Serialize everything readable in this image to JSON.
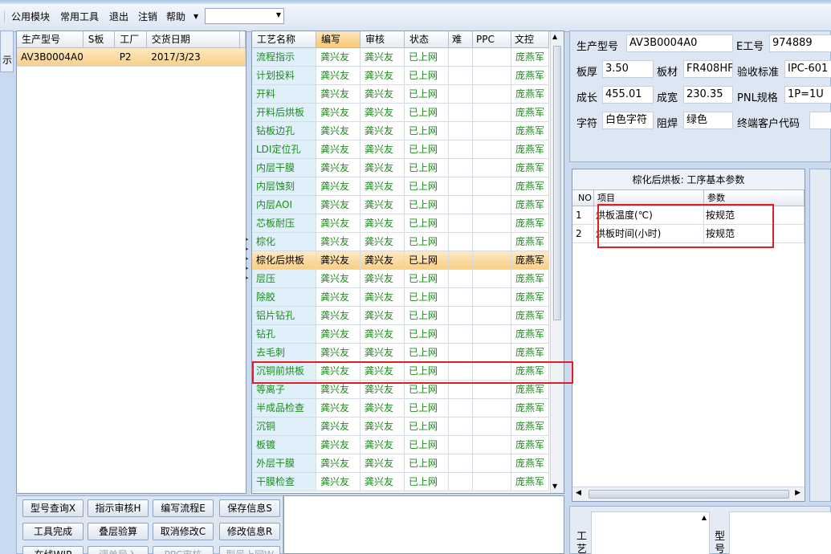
{
  "menu": {
    "items": [
      "公用模块",
      "常用工具",
      "退出",
      "注销",
      "帮助"
    ],
    "combo_value": ""
  },
  "left_stub_text": "示",
  "orders": {
    "headers": [
      "生产型号",
      "S板",
      "工厂",
      "交货日期"
    ],
    "rows": [
      [
        "AV3B0004A0",
        "",
        "P2",
        "2017/3/23"
      ]
    ]
  },
  "process": {
    "headers": [
      "工艺名称",
      "编写",
      "审核",
      "状态",
      "难",
      "PPC",
      "文控"
    ],
    "rows": [
      [
        "流程指示",
        "龚兴友",
        "龚兴友",
        "已上网",
        "",
        "",
        "庞燕军"
      ],
      [
        "计划投料",
        "龚兴友",
        "龚兴友",
        "已上网",
        "",
        "",
        "庞燕军"
      ],
      [
        "开料",
        "龚兴友",
        "龚兴友",
        "已上网",
        "",
        "",
        "庞燕军"
      ],
      [
        "开料后烘板",
        "龚兴友",
        "龚兴友",
        "已上网",
        "",
        "",
        "庞燕军"
      ],
      [
        "钻板边孔",
        "龚兴友",
        "龚兴友",
        "已上网",
        "",
        "",
        "庞燕军"
      ],
      [
        "LDI定位孔",
        "龚兴友",
        "龚兴友",
        "已上网",
        "",
        "",
        "庞燕军"
      ],
      [
        "内层干膜",
        "龚兴友",
        "龚兴友",
        "已上网",
        "",
        "",
        "庞燕军"
      ],
      [
        "内层蚀刻",
        "龚兴友",
        "龚兴友",
        "已上网",
        "",
        "",
        "庞燕军"
      ],
      [
        "内层AOI",
        "龚兴友",
        "龚兴友",
        "已上网",
        "",
        "",
        "庞燕军"
      ],
      [
        "芯板耐压",
        "龚兴友",
        "龚兴友",
        "已上网",
        "",
        "",
        "庞燕军"
      ],
      [
        "棕化",
        "龚兴友",
        "龚兴友",
        "已上网",
        "",
        "",
        "庞燕军"
      ],
      [
        "棕化后烘板",
        "龚兴友",
        "龚兴友",
        "已上网",
        "",
        "",
        "庞燕军"
      ],
      [
        "层压",
        "龚兴友",
        "龚兴友",
        "已上网",
        "",
        "",
        "庞燕军"
      ],
      [
        "除胶",
        "龚兴友",
        "龚兴友",
        "已上网",
        "",
        "",
        "庞燕军"
      ],
      [
        "铝片钻孔",
        "龚兴友",
        "龚兴友",
        "已上网",
        "",
        "",
        "庞燕军"
      ],
      [
        "钻孔",
        "龚兴友",
        "龚兴友",
        "已上网",
        "",
        "",
        "庞燕军"
      ],
      [
        "去毛刺",
        "龚兴友",
        "龚兴友",
        "已上网",
        "",
        "",
        "庞燕军"
      ],
      [
        "沉铜前烘板",
        "龚兴友",
        "龚兴友",
        "已上网",
        "",
        "",
        "庞燕军"
      ],
      [
        "等离子",
        "龚兴友",
        "龚兴友",
        "已上网",
        "",
        "",
        "庞燕军"
      ],
      [
        "半成品检查",
        "龚兴友",
        "龚兴友",
        "已上网",
        "",
        "",
        "庞燕军"
      ],
      [
        "沉铜",
        "龚兴友",
        "龚兴友",
        "已上网",
        "",
        "",
        "庞燕军"
      ],
      [
        "板镀",
        "龚兴友",
        "龚兴友",
        "已上网",
        "",
        "",
        "庞燕军"
      ],
      [
        "外层干膜",
        "龚兴友",
        "龚兴友",
        "已上网",
        "",
        "",
        "庞燕军"
      ],
      [
        "干膜检查",
        "龚兴友",
        "龚兴友",
        "已上网",
        "",
        "",
        "庞燕军"
      ]
    ]
  },
  "info": {
    "model_label": "生产型号",
    "model_value": "AV3B0004A0",
    "eno_label": "E工号",
    "eno_value": "974889",
    "thickness_label": "板厚",
    "thickness_value": "3.50",
    "material_label": "板材",
    "material_value": "FR408HF",
    "standard_label": "验收标准",
    "standard_value": "IPC-601",
    "length_label": "成长",
    "length_value": "455.01",
    "width_label": "成宽",
    "width_value": "230.35",
    "pnl_label": "PNL规格",
    "pnl_value": "1P=1U",
    "char_label": "字符",
    "char_value": "白色字符",
    "mask_label": "阻焊",
    "mask_value": "绿色",
    "customer_label": "终端客户代码",
    "customer_value": ""
  },
  "params": {
    "title": "棕化后烘板: 工序基本参数",
    "headers": [
      "NO",
      "项目",
      "参数"
    ],
    "rows": [
      [
        "1",
        "烘板温度(℃)",
        "按规范"
      ],
      [
        "2",
        "烘板时间(小时)",
        "按规范"
      ]
    ]
  },
  "buttons": [
    [
      "型号查询X",
      "指示审核H",
      "编写流程E",
      "保存信息S"
    ],
    [
      "工具完成",
      "叠层验算",
      "取消修改C",
      "修改信息R"
    ],
    [
      "在线WIP",
      "调单导入",
      "PPC审核",
      "型号上网W"
    ]
  ],
  "bottom_right": {
    "label_left": "工艺",
    "label_right": "型号"
  }
}
